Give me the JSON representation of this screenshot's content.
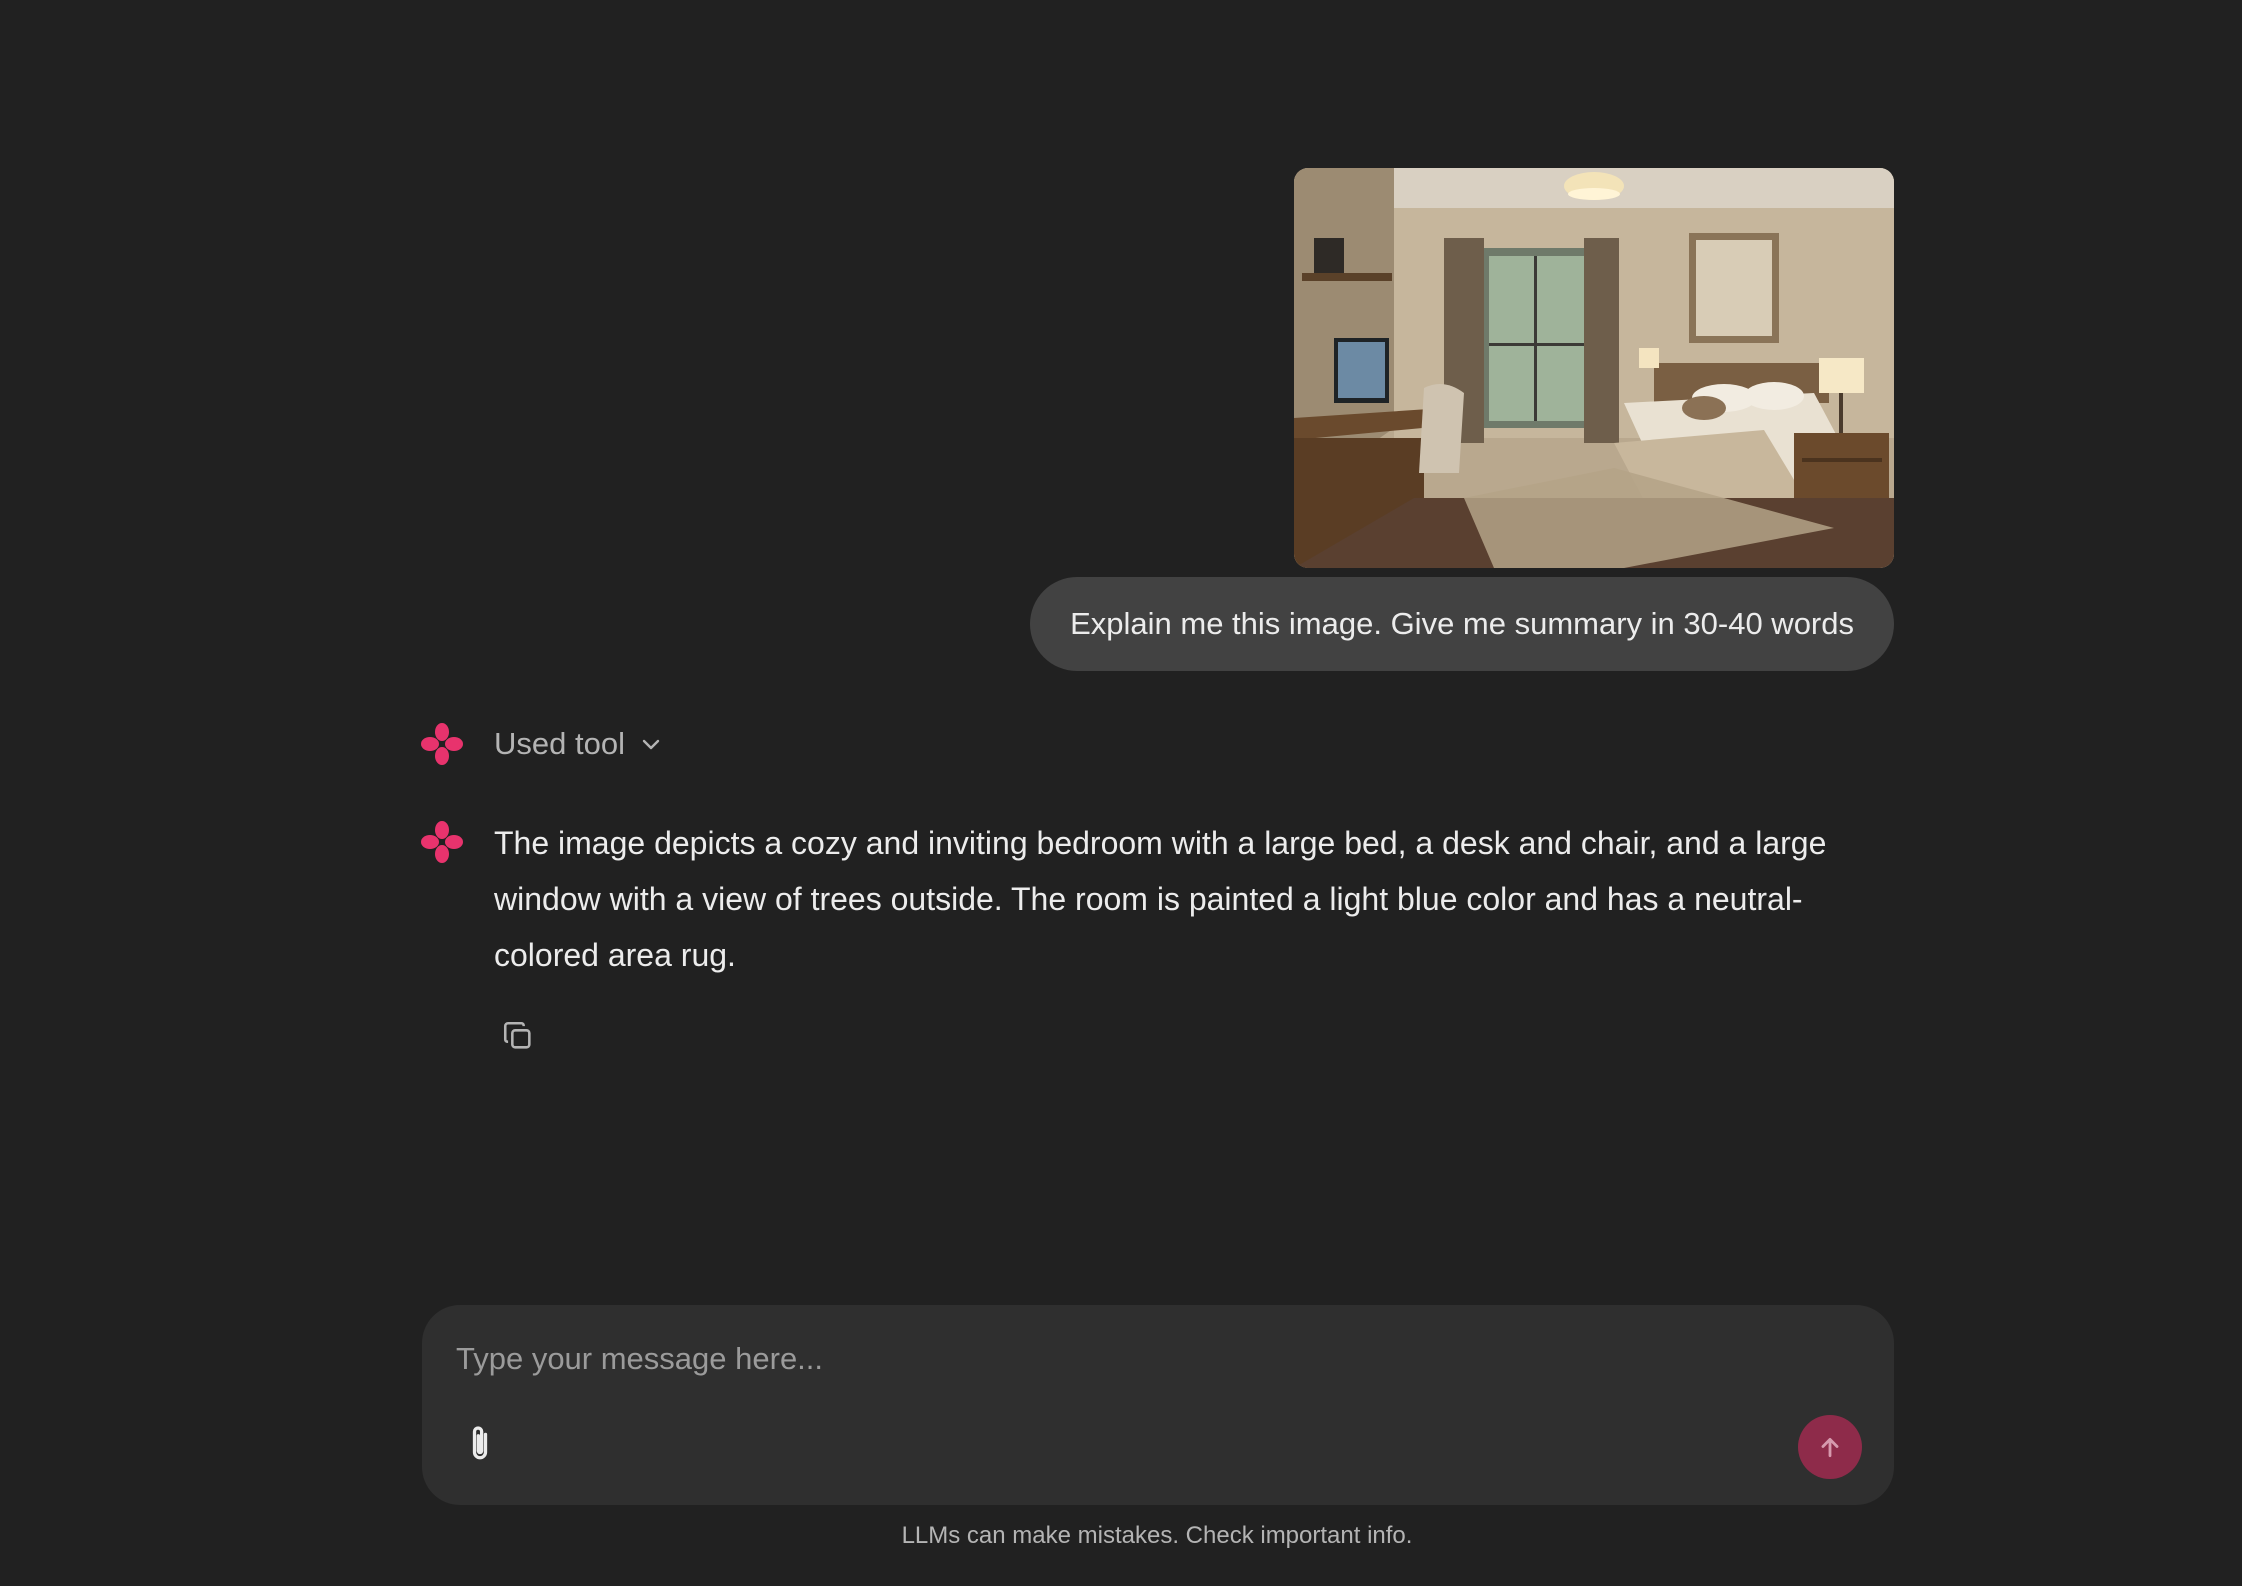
{
  "conversation": {
    "user_message": {
      "image_alt": "Uploaded bedroom image",
      "text": "Explain me this image. Give me summary in 30-40 words"
    },
    "tool_status": {
      "label": "Used tool"
    },
    "assistant_message": {
      "text": "The image depicts a cozy and inviting bedroom with a large bed, a desk and chair, and a large window with a view of trees outside. The room is painted a light blue color and has a neutral-colored area rug."
    }
  },
  "composer": {
    "placeholder": "Type your message here..."
  },
  "footer": {
    "disclaimer": "LLMs can make mistakes. Check important info."
  },
  "colors": {
    "background": "#212121",
    "bubble": "#424242",
    "composer": "#2f2f2f",
    "accent": "#e8336d",
    "send_button": "#8e2b4a"
  },
  "icons": {
    "assistant_logo": "flower-logo-icon",
    "tool_toggle": "chevron-down-icon",
    "copy": "copy-icon",
    "attach": "paperclip-icon",
    "send": "arrow-up-icon"
  }
}
